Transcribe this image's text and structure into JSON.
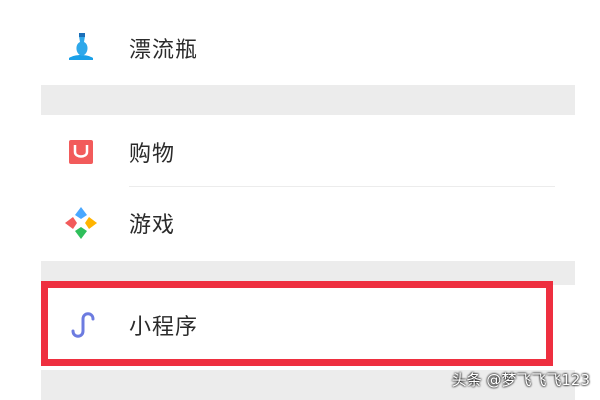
{
  "menu": {
    "items": [
      {
        "label": "漂流瓶",
        "icon": "drift-bottle-icon"
      },
      {
        "label": "购物",
        "icon": "shopping-bag-icon"
      },
      {
        "label": "游戏",
        "icon": "games-icon"
      },
      {
        "label": "小程序",
        "icon": "mini-program-icon"
      }
    ]
  },
  "watermark": {
    "text": "头条 @梦飞飞飞123"
  },
  "colors": {
    "highlight_border": "#ee2f3f",
    "section_gap": "#ececec",
    "shopping_icon": "#f25b5b",
    "mini_program_icon": "#6c7be0"
  }
}
